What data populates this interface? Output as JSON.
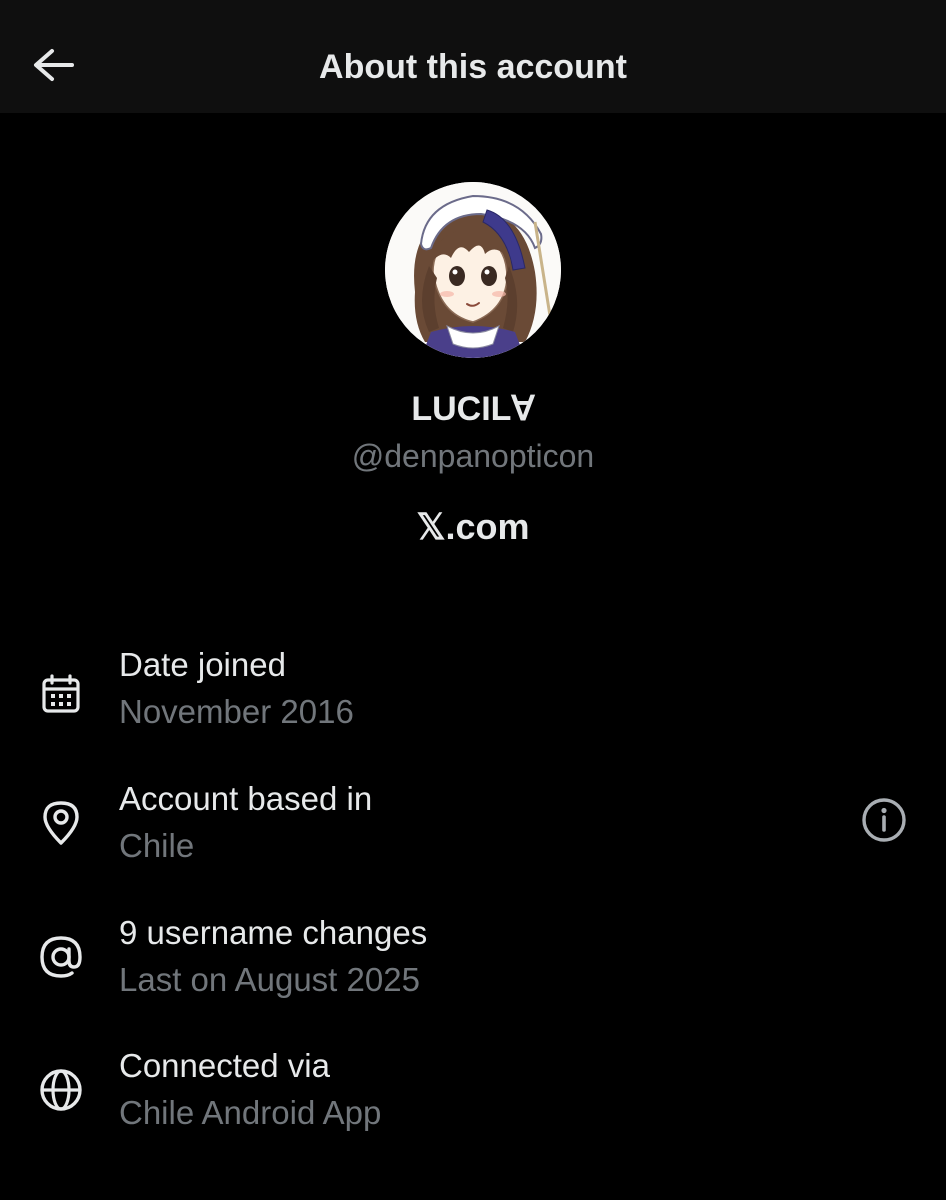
{
  "header": {
    "title": "About this account",
    "back_icon": "arrow-left-icon"
  },
  "profile": {
    "display_name": "LUCIL∀",
    "handle": "@denpanopticon",
    "site": "𝕏.com",
    "avatar": "anime-maid-girl-avatar"
  },
  "details": [
    {
      "icon": "calendar-icon",
      "label": "Date joined",
      "value": "November 2016"
    },
    {
      "icon": "location-pin-icon",
      "label": "Account based in",
      "value": "Chile",
      "info_icon": "info-icon"
    },
    {
      "icon": "at-sign-icon",
      "label": "9 username changes",
      "value": "Last on August 2025"
    },
    {
      "icon": "globe-icon",
      "label": "Connected via",
      "value": "Chile Android App"
    }
  ],
  "colors": {
    "background": "#000000",
    "header_background": "#0f0f0f",
    "primary_text": "#e7e9ea",
    "secondary_text": "#71767b"
  }
}
